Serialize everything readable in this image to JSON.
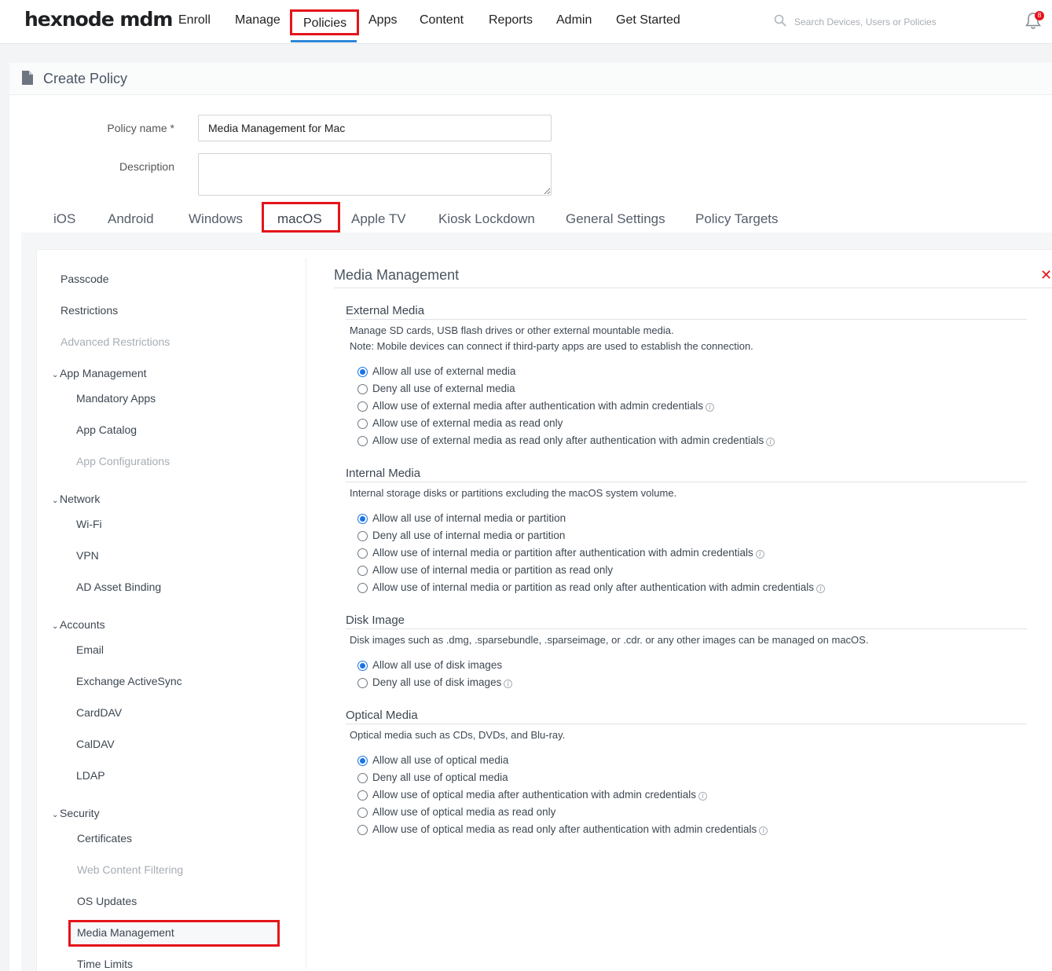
{
  "app": {
    "logo": "hexnode mdm"
  },
  "nav": {
    "items": [
      "Enroll",
      "Manage",
      "Policies",
      "Apps",
      "Content",
      "Reports",
      "Admin",
      "Get Started"
    ],
    "active": "Policies",
    "search_placeholder": "Search Devices, Users or Policies",
    "notification_count": "8"
  },
  "page": {
    "title": "Create Policy",
    "policy_name_label": "Policy name *",
    "policy_name_value": "Media Management for Mac",
    "description_label": "Description",
    "description_value": ""
  },
  "os_tabs": {
    "items": [
      "iOS",
      "Android",
      "Windows",
      "macOS",
      "Apple TV",
      "Kiosk Lockdown",
      "General Settings",
      "Policy Targets"
    ],
    "active": "macOS"
  },
  "sidebar": {
    "top": [
      {
        "label": "Passcode",
        "disabled": false
      },
      {
        "label": "Restrictions",
        "disabled": false
      },
      {
        "label": "Advanced Restrictions",
        "disabled": true
      }
    ],
    "groups": [
      {
        "label": "App Management",
        "items": [
          {
            "label": "Mandatory Apps",
            "disabled": false
          },
          {
            "label": "App Catalog",
            "disabled": false
          },
          {
            "label": "App Configurations",
            "disabled": true
          }
        ]
      },
      {
        "label": "Network",
        "items": [
          {
            "label": "Wi-Fi",
            "disabled": false
          },
          {
            "label": "VPN",
            "disabled": false
          },
          {
            "label": "AD Asset Binding",
            "disabled": false
          }
        ]
      },
      {
        "label": "Accounts",
        "items": [
          {
            "label": "Email",
            "disabled": false
          },
          {
            "label": "Exchange ActiveSync",
            "disabled": false
          },
          {
            "label": "CardDAV",
            "disabled": false
          },
          {
            "label": "CalDAV",
            "disabled": false
          },
          {
            "label": "LDAP",
            "disabled": false
          }
        ]
      },
      {
        "label": "Security",
        "items": [
          {
            "label": "Certificates",
            "disabled": false
          },
          {
            "label": "Web Content Filtering",
            "disabled": true
          },
          {
            "label": "OS Updates",
            "disabled": false
          },
          {
            "label": "Media Management",
            "disabled": false
          },
          {
            "label": "Time Limits",
            "disabled": false
          }
        ]
      }
    ],
    "active": "Media Management"
  },
  "content": {
    "title": "Media Management",
    "sections": [
      {
        "title": "External Media",
        "description": [
          "Manage SD cards, USB flash drives or other external mountable media.",
          "Note: Mobile devices can connect if third-party apps are used to establish the connection."
        ],
        "options": [
          {
            "label": "Allow all use of external media",
            "checked": true,
            "info": false
          },
          {
            "label": "Deny all use of external media",
            "checked": false,
            "info": false
          },
          {
            "label": "Allow use of external media after authentication with admin credentials",
            "checked": false,
            "info": true
          },
          {
            "label": "Allow use of external media as read only",
            "checked": false,
            "info": false
          },
          {
            "label": "Allow use of external media as read only after authentication with admin credentials",
            "checked": false,
            "info": true
          }
        ]
      },
      {
        "title": "Internal Media",
        "description": [
          "Internal storage disks or partitions excluding the macOS system volume."
        ],
        "options": [
          {
            "label": "Allow all use of internal media or partition",
            "checked": true,
            "info": false
          },
          {
            "label": "Deny all use of internal media or partition",
            "checked": false,
            "info": false
          },
          {
            "label": "Allow use of internal media or partition after authentication with admin credentials",
            "checked": false,
            "info": true
          },
          {
            "label": "Allow use of internal media or partition as read only",
            "checked": false,
            "info": false
          },
          {
            "label": "Allow use of internal media or partition as read only after authentication with admin credentials",
            "checked": false,
            "info": true
          }
        ]
      },
      {
        "title": "Disk Image",
        "description": [
          "Disk images such as .dmg, .sparsebundle, .sparseimage, or .cdr. or any other images can be managed on macOS."
        ],
        "options": [
          {
            "label": "Allow all use of disk images",
            "checked": true,
            "info": false
          },
          {
            "label": "Deny all use of disk images",
            "checked": false,
            "info": true
          }
        ]
      },
      {
        "title": "Optical Media",
        "description": [
          "Optical media such as CDs, DVDs, and Blu-ray."
        ],
        "options": [
          {
            "label": "Allow all use of optical media",
            "checked": true,
            "info": false
          },
          {
            "label": "Deny all use of optical media",
            "checked": false,
            "info": false
          },
          {
            "label": "Allow use of optical media after authentication with admin credentials",
            "checked": false,
            "info": true
          },
          {
            "label": "Allow use of optical media as read only",
            "checked": false,
            "info": false
          },
          {
            "label": "Allow use of optical media as read only after authentication with admin credentials",
            "checked": false,
            "info": true
          }
        ]
      }
    ]
  },
  "colors": {
    "accent": "#2d86d8",
    "highlight": "#e4141b",
    "radio": "#1a73e8"
  }
}
